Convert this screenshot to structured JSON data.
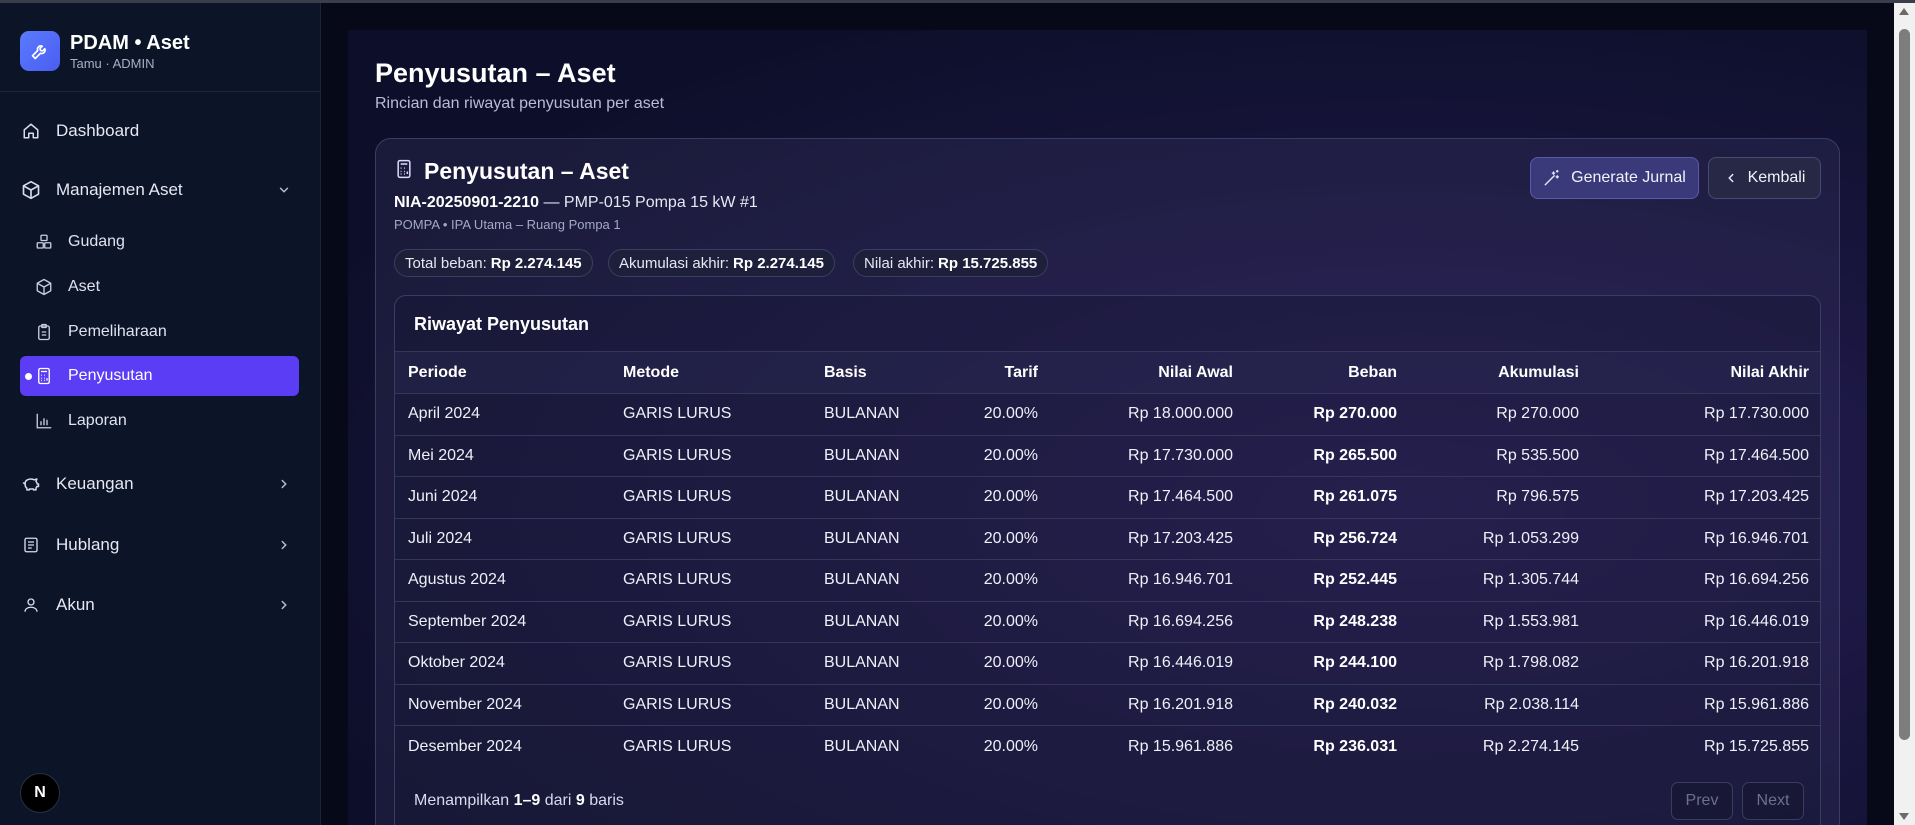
{
  "sidebar": {
    "brand_title": "PDAM • Aset",
    "brand_sub": "Tamu · ADMIN",
    "nav": {
      "dashboard": "Dashboard",
      "manajemen": "Manajemen Aset",
      "keuangan": "Keuangan",
      "hublang": "Hublang",
      "akun": "Akun"
    },
    "sub": {
      "gudang": "Gudang",
      "aset": "Aset",
      "pemeliharaan": "Pemeliharaan",
      "penyusutan": "Penyusutan",
      "laporan": "Laporan"
    },
    "badge": "N"
  },
  "page": {
    "title": "Penyusutan – Aset",
    "subtitle": "Rincian dan riwayat penyusutan per aset"
  },
  "card": {
    "title": "Penyusutan – Aset",
    "asset_code": "NIA-20250901-2210",
    "asset_desc": " — PMP-015 Pompa 15 kW #1",
    "location": "POMPA • IPA Utama – Ruang Pompa 1",
    "pills": {
      "total_label": "Total beban:",
      "total_value": "Rp 2.274.145",
      "akum_label": "Akumulasi akhir:",
      "akum_value": "Rp 2.274.145",
      "nilai_label": "Nilai akhir:",
      "nilai_value": "Rp 15.725.855"
    },
    "buttons": {
      "generate": "Generate Jurnal",
      "back": "Kembali"
    }
  },
  "table": {
    "title": "Riwayat Penyusutan",
    "headers": [
      "Periode",
      "Metode",
      "Basis",
      "Tarif",
      "Nilai Awal",
      "Beban",
      "Akumulasi",
      "Nilai Akhir"
    ],
    "rows": [
      [
        "April 2024",
        "GARIS LURUS",
        "BULANAN",
        "20.00%",
        "Rp 18.000.000",
        "Rp 270.000",
        "Rp 270.000",
        "Rp 17.730.000"
      ],
      [
        "Mei 2024",
        "GARIS LURUS",
        "BULANAN",
        "20.00%",
        "Rp 17.730.000",
        "Rp 265.500",
        "Rp 535.500",
        "Rp 17.464.500"
      ],
      [
        "Juni 2024",
        "GARIS LURUS",
        "BULANAN",
        "20.00%",
        "Rp 17.464.500",
        "Rp 261.075",
        "Rp 796.575",
        "Rp 17.203.425"
      ],
      [
        "Juli 2024",
        "GARIS LURUS",
        "BULANAN",
        "20.00%",
        "Rp 17.203.425",
        "Rp 256.724",
        "Rp 1.053.299",
        "Rp 16.946.701"
      ],
      [
        "Agustus 2024",
        "GARIS LURUS",
        "BULANAN",
        "20.00%",
        "Rp 16.946.701",
        "Rp 252.445",
        "Rp 1.305.744",
        "Rp 16.694.256"
      ],
      [
        "September 2024",
        "GARIS LURUS",
        "BULANAN",
        "20.00%",
        "Rp 16.694.256",
        "Rp 248.238",
        "Rp 1.553.981",
        "Rp 16.446.019"
      ],
      [
        "Oktober 2024",
        "GARIS LURUS",
        "BULANAN",
        "20.00%",
        "Rp 16.446.019",
        "Rp 244.100",
        "Rp 1.798.082",
        "Rp 16.201.918"
      ],
      [
        "November 2024",
        "GARIS LURUS",
        "BULANAN",
        "20.00%",
        "Rp 16.201.918",
        "Rp 240.032",
        "Rp 2.038.114",
        "Rp 15.961.886"
      ],
      [
        "Desember 2024",
        "GARIS LURUS",
        "BULANAN",
        "20.00%",
        "Rp 15.961.886",
        "Rp 236.031",
        "Rp 2.274.145",
        "Rp 15.725.855"
      ]
    ],
    "footer": {
      "prefix": "Menampilkan ",
      "range": "1–9",
      "mid": " dari ",
      "total": "9",
      "suffix": " baris"
    },
    "prev": "Prev",
    "next": "Next"
  }
}
